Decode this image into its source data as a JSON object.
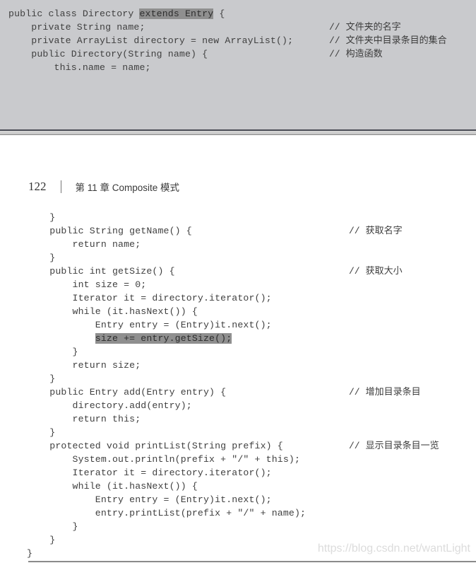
{
  "top_snippet": {
    "lines": [
      {
        "pre": "public class Directory ",
        "hl": "extends Entry",
        "post": " {"
      },
      {
        "text": "    private String name;"
      },
      {
        "text": "    private ArrayList directory = new ArrayList();"
      },
      {
        "text": "    public Directory(String name) {"
      },
      {
        "text": "        this.name = name;"
      }
    ],
    "comments": [
      {
        "slashes": "//",
        "text": "文件夹的名字"
      },
      {
        "slashes": "//",
        "text": "文件夹中目录条目的集合"
      },
      {
        "slashes": "//",
        "text": "构造函数"
      }
    ]
  },
  "page_header": {
    "page_number": "122",
    "chapter": "第 11 章   Composite 模式"
  },
  "main_code": {
    "lines": [
      {
        "text": "    }"
      },
      {
        "text": "    public String getName() {"
      },
      {
        "text": "        return name;"
      },
      {
        "text": "    }"
      },
      {
        "text": "    public int getSize() {"
      },
      {
        "text": "        int size = 0;"
      },
      {
        "text": "        Iterator it = directory.iterator();"
      },
      {
        "text": "        while (it.hasNext()) {"
      },
      {
        "text": "            Entry entry = (Entry)it.next();"
      },
      {
        "pre": "            ",
        "hl": "size += entry.getSize();",
        "post": ""
      },
      {
        "text": "        }"
      },
      {
        "text": "        return size;"
      },
      {
        "text": "    }"
      },
      {
        "text": "    public Entry add(Entry entry) {"
      },
      {
        "text": "        directory.add(entry);"
      },
      {
        "text": "        return this;"
      },
      {
        "text": "    }"
      },
      {
        "text": "    protected void printList(String prefix) {"
      },
      {
        "text": "        System.out.println(prefix + \"/\" + this);"
      },
      {
        "text": "        Iterator it = directory.iterator();"
      },
      {
        "text": "        while (it.hasNext()) {"
      },
      {
        "text": "            Entry entry = (Entry)it.next();"
      },
      {
        "text": "            entry.printList(prefix + \"/\" + name);"
      },
      {
        "text": "        }"
      },
      {
        "text": "    }"
      },
      {
        "text": "}"
      }
    ],
    "comments": [
      {
        "slashes": "//",
        "text": "获取名字"
      },
      {
        "slashes": "//",
        "text": "获取大小"
      },
      {
        "slashes": "//",
        "text": "增加目录条目"
      },
      {
        "slashes": "//",
        "text": "显示目录条目一览"
      }
    ]
  },
  "watermark": "https://blog.csdn.net/wantLight"
}
